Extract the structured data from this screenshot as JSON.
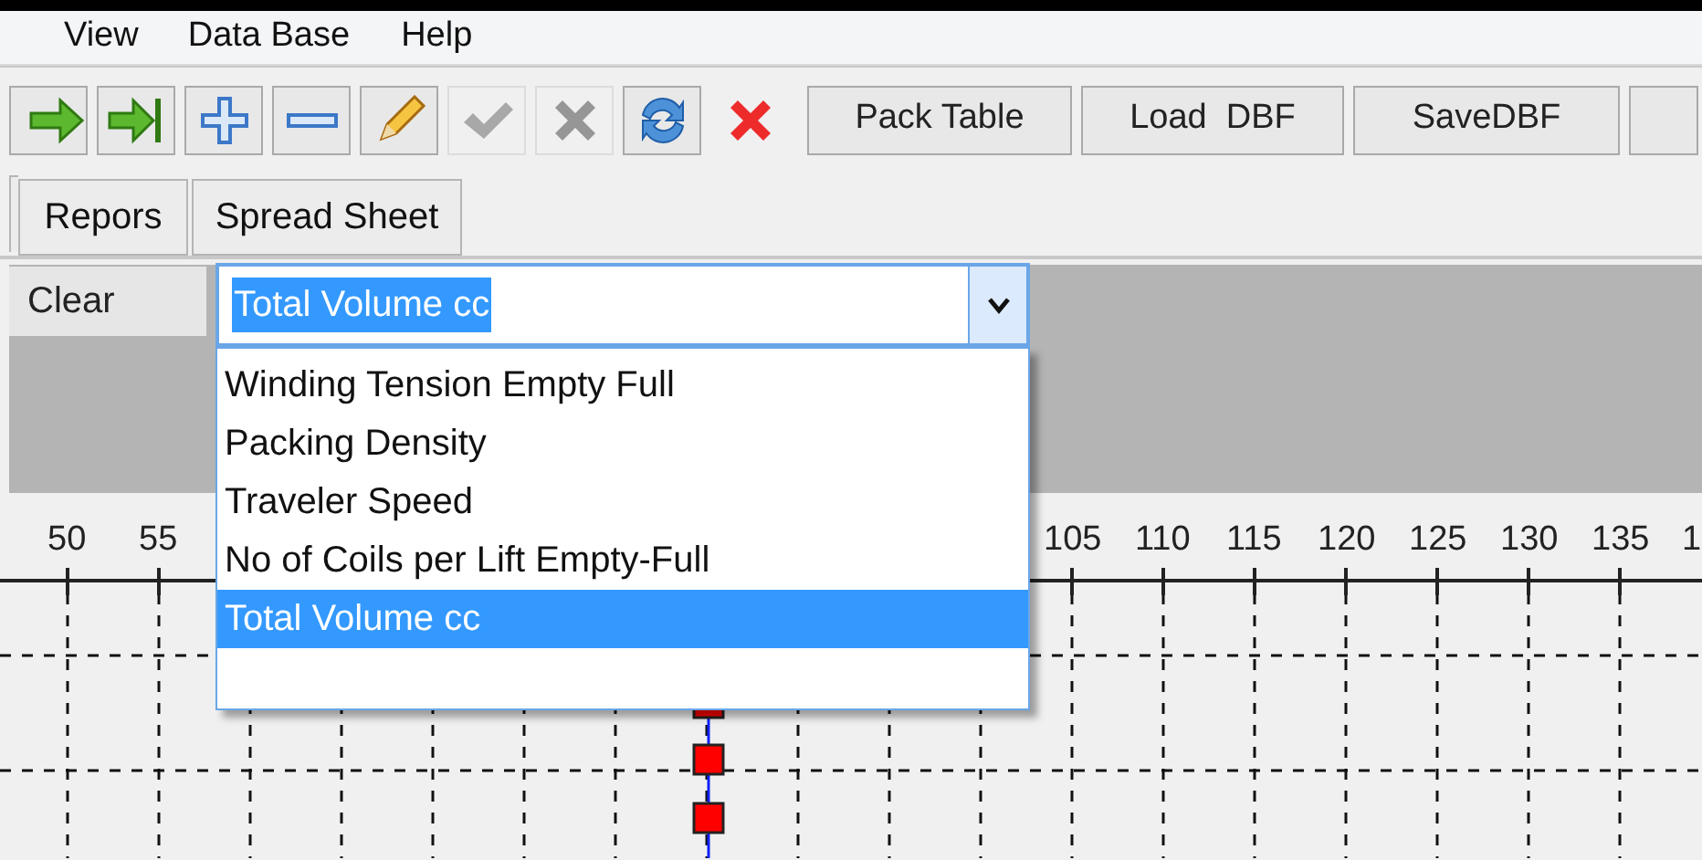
{
  "menu": [
    "View",
    "Data Base",
    "Help"
  ],
  "toolbar": {
    "icons": [
      {
        "kind": "next",
        "disabled": false
      },
      {
        "kind": "last",
        "disabled": false
      },
      {
        "kind": "add",
        "disabled": false
      },
      {
        "kind": "remove",
        "disabled": false
      },
      {
        "kind": "edit",
        "disabled": false
      },
      {
        "kind": "confirm",
        "disabled": true
      },
      {
        "kind": "cancel",
        "disabled": true
      },
      {
        "kind": "refresh",
        "disabled": false
      },
      {
        "kind": "delete",
        "disabled": false
      }
    ],
    "buttons": [
      "Pack Table",
      "Load  DBF",
      "SaveDBF"
    ]
  },
  "tabs": [
    {
      "label": "Repors",
      "selected": false
    },
    {
      "label": "Spread Sheet",
      "selected": false
    }
  ],
  "clear_button": "Clear",
  "combo": {
    "value": "Total Volume cc",
    "options": [
      {
        "label": "Winding Tension Empty Full",
        "selected": false
      },
      {
        "label": "Packing Density",
        "selected": false
      },
      {
        "label": "Traveler Speed",
        "selected": false
      },
      {
        "label": "No of Coils per Lift Empty-Full",
        "selected": false
      },
      {
        "label": "Total Volume cc",
        "selected": true
      }
    ]
  },
  "x_axis": {
    "labels": [
      "50",
      "55",
      "105",
      "110",
      "115",
      "120",
      "125",
      "130",
      "135",
      "1"
    ]
  }
}
